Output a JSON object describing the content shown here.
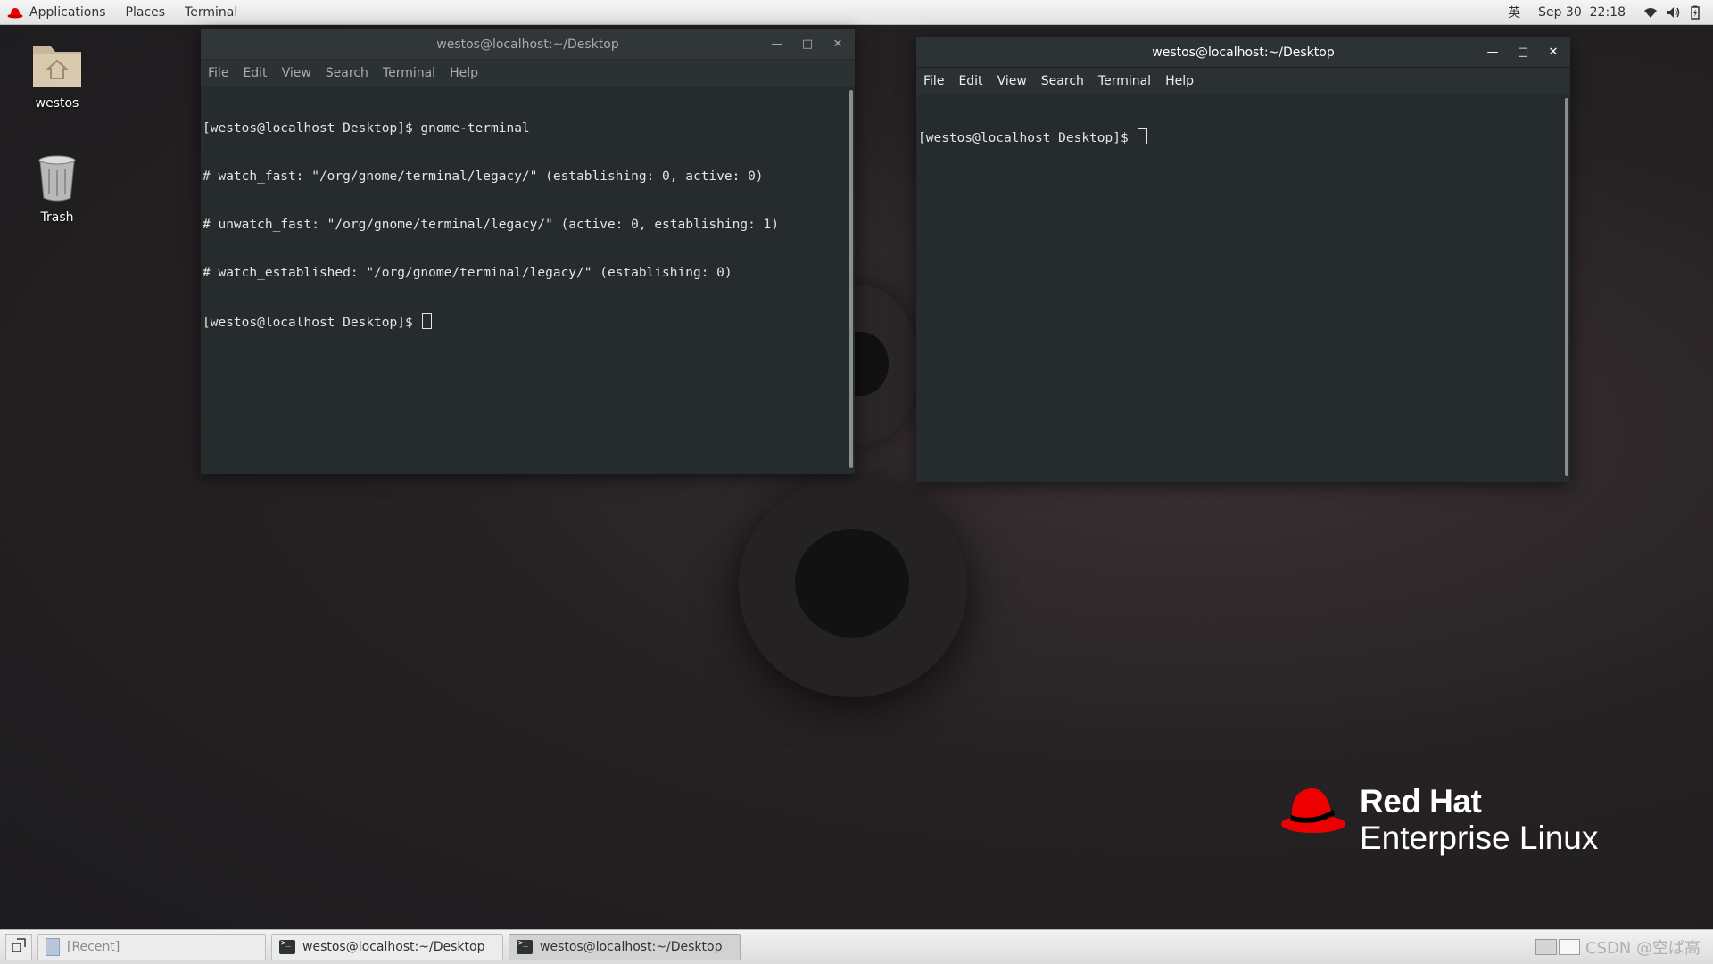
{
  "topbar": {
    "applications": "Applications",
    "places": "Places",
    "terminal": "Terminal",
    "input_method": "英",
    "datetime": "Sep 30  22:18",
    "icons": [
      "wifi-icon",
      "volume-icon",
      "battery-icon"
    ]
  },
  "desktop": {
    "icons": [
      {
        "label": "westos",
        "icon": "home-folder-icon"
      },
      {
        "label": "Trash",
        "icon": "trash-icon"
      }
    ]
  },
  "brand": {
    "line1": "Red Hat",
    "line2": "Enterprise Linux"
  },
  "windows": {
    "left": {
      "title": "westos@localhost:~/Desktop",
      "menu": [
        "File",
        "Edit",
        "View",
        "Search",
        "Terminal",
        "Help"
      ],
      "lines": [
        "[westos@localhost Desktop]$ gnome-terminal",
        "# watch_fast: \"/org/gnome/terminal/legacy/\" (establishing: 0, active: 0)",
        "# unwatch_fast: \"/org/gnome/terminal/legacy/\" (active: 0, establishing: 1)",
        "# watch_established: \"/org/gnome/terminal/legacy/\" (establishing: 0)"
      ],
      "prompt": "[westos@localhost Desktop]$ "
    },
    "right": {
      "title": "westos@localhost:~/Desktop",
      "menu": [
        "File",
        "Edit",
        "View",
        "Search",
        "Terminal",
        "Help"
      ],
      "prompt": "[westos@localhost Desktop]$ "
    }
  },
  "taskbar": {
    "items": [
      {
        "label": "[Recent]"
      },
      {
        "label": "westos@localhost:~/Desktop"
      },
      {
        "label": "westos@localhost:~/Desktop"
      }
    ],
    "watermark": "CSDN @空ば高"
  },
  "colors": {
    "redhat_red": "#ee0000",
    "terminal_bg": "#262b2d"
  }
}
